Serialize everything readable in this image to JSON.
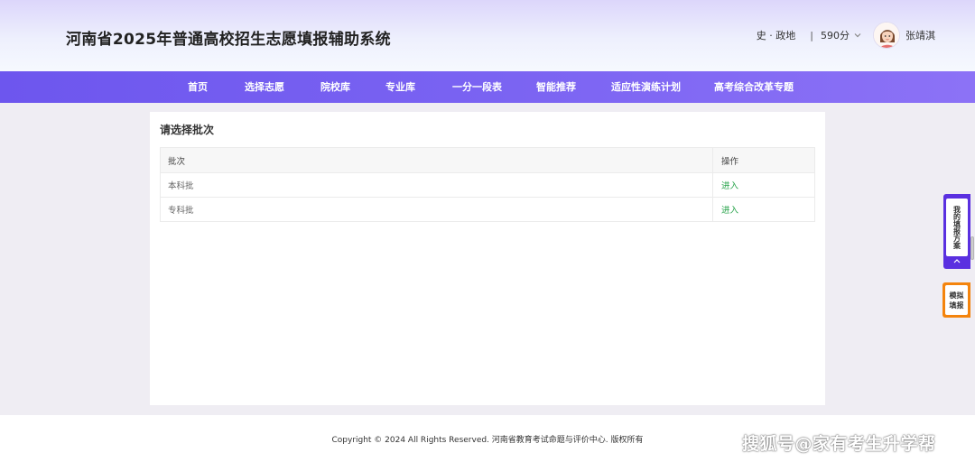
{
  "header": {
    "site_title": "河南省2025年普通高校招生志愿填报辅助系统",
    "subjects": "史 · 政地",
    "separator": "|",
    "score": "590分",
    "username": "张靖淇"
  },
  "nav": {
    "items": [
      {
        "label": "首页"
      },
      {
        "label": "选择志愿"
      },
      {
        "label": "院校库"
      },
      {
        "label": "专业库"
      },
      {
        "label": "一分一段表"
      },
      {
        "label": "智能推荐"
      },
      {
        "label": "适应性演练计划"
      },
      {
        "label": "高考综合改革专题"
      }
    ]
  },
  "main": {
    "title": "请选择批次",
    "table": {
      "columns": [
        "批次",
        "操作"
      ],
      "rows": [
        {
          "batch": "本科批",
          "action": "进入"
        },
        {
          "batch": "专科批",
          "action": "进入"
        }
      ]
    }
  },
  "sidebar": {
    "plan_label": "我的填报方案",
    "sim_label": "模拟填报"
  },
  "footer": {
    "copyright": "Copyright © 2024 All Rights Reserved. 河南省教育考试命题与评价中心. 版权所有"
  },
  "watermark": "搜狐号@家有考生升学帮",
  "icons": {
    "score_dropdown": "chevron-down-icon",
    "avatar": "avatar-icon",
    "collapse": "chevron-up-icon"
  },
  "colors": {
    "nav_start": "#6d56ee",
    "nav_end": "#8c72f6",
    "link_green": "#27a34a",
    "plan_purple": "#5a30e0",
    "sim_orange": "#f4840d"
  }
}
